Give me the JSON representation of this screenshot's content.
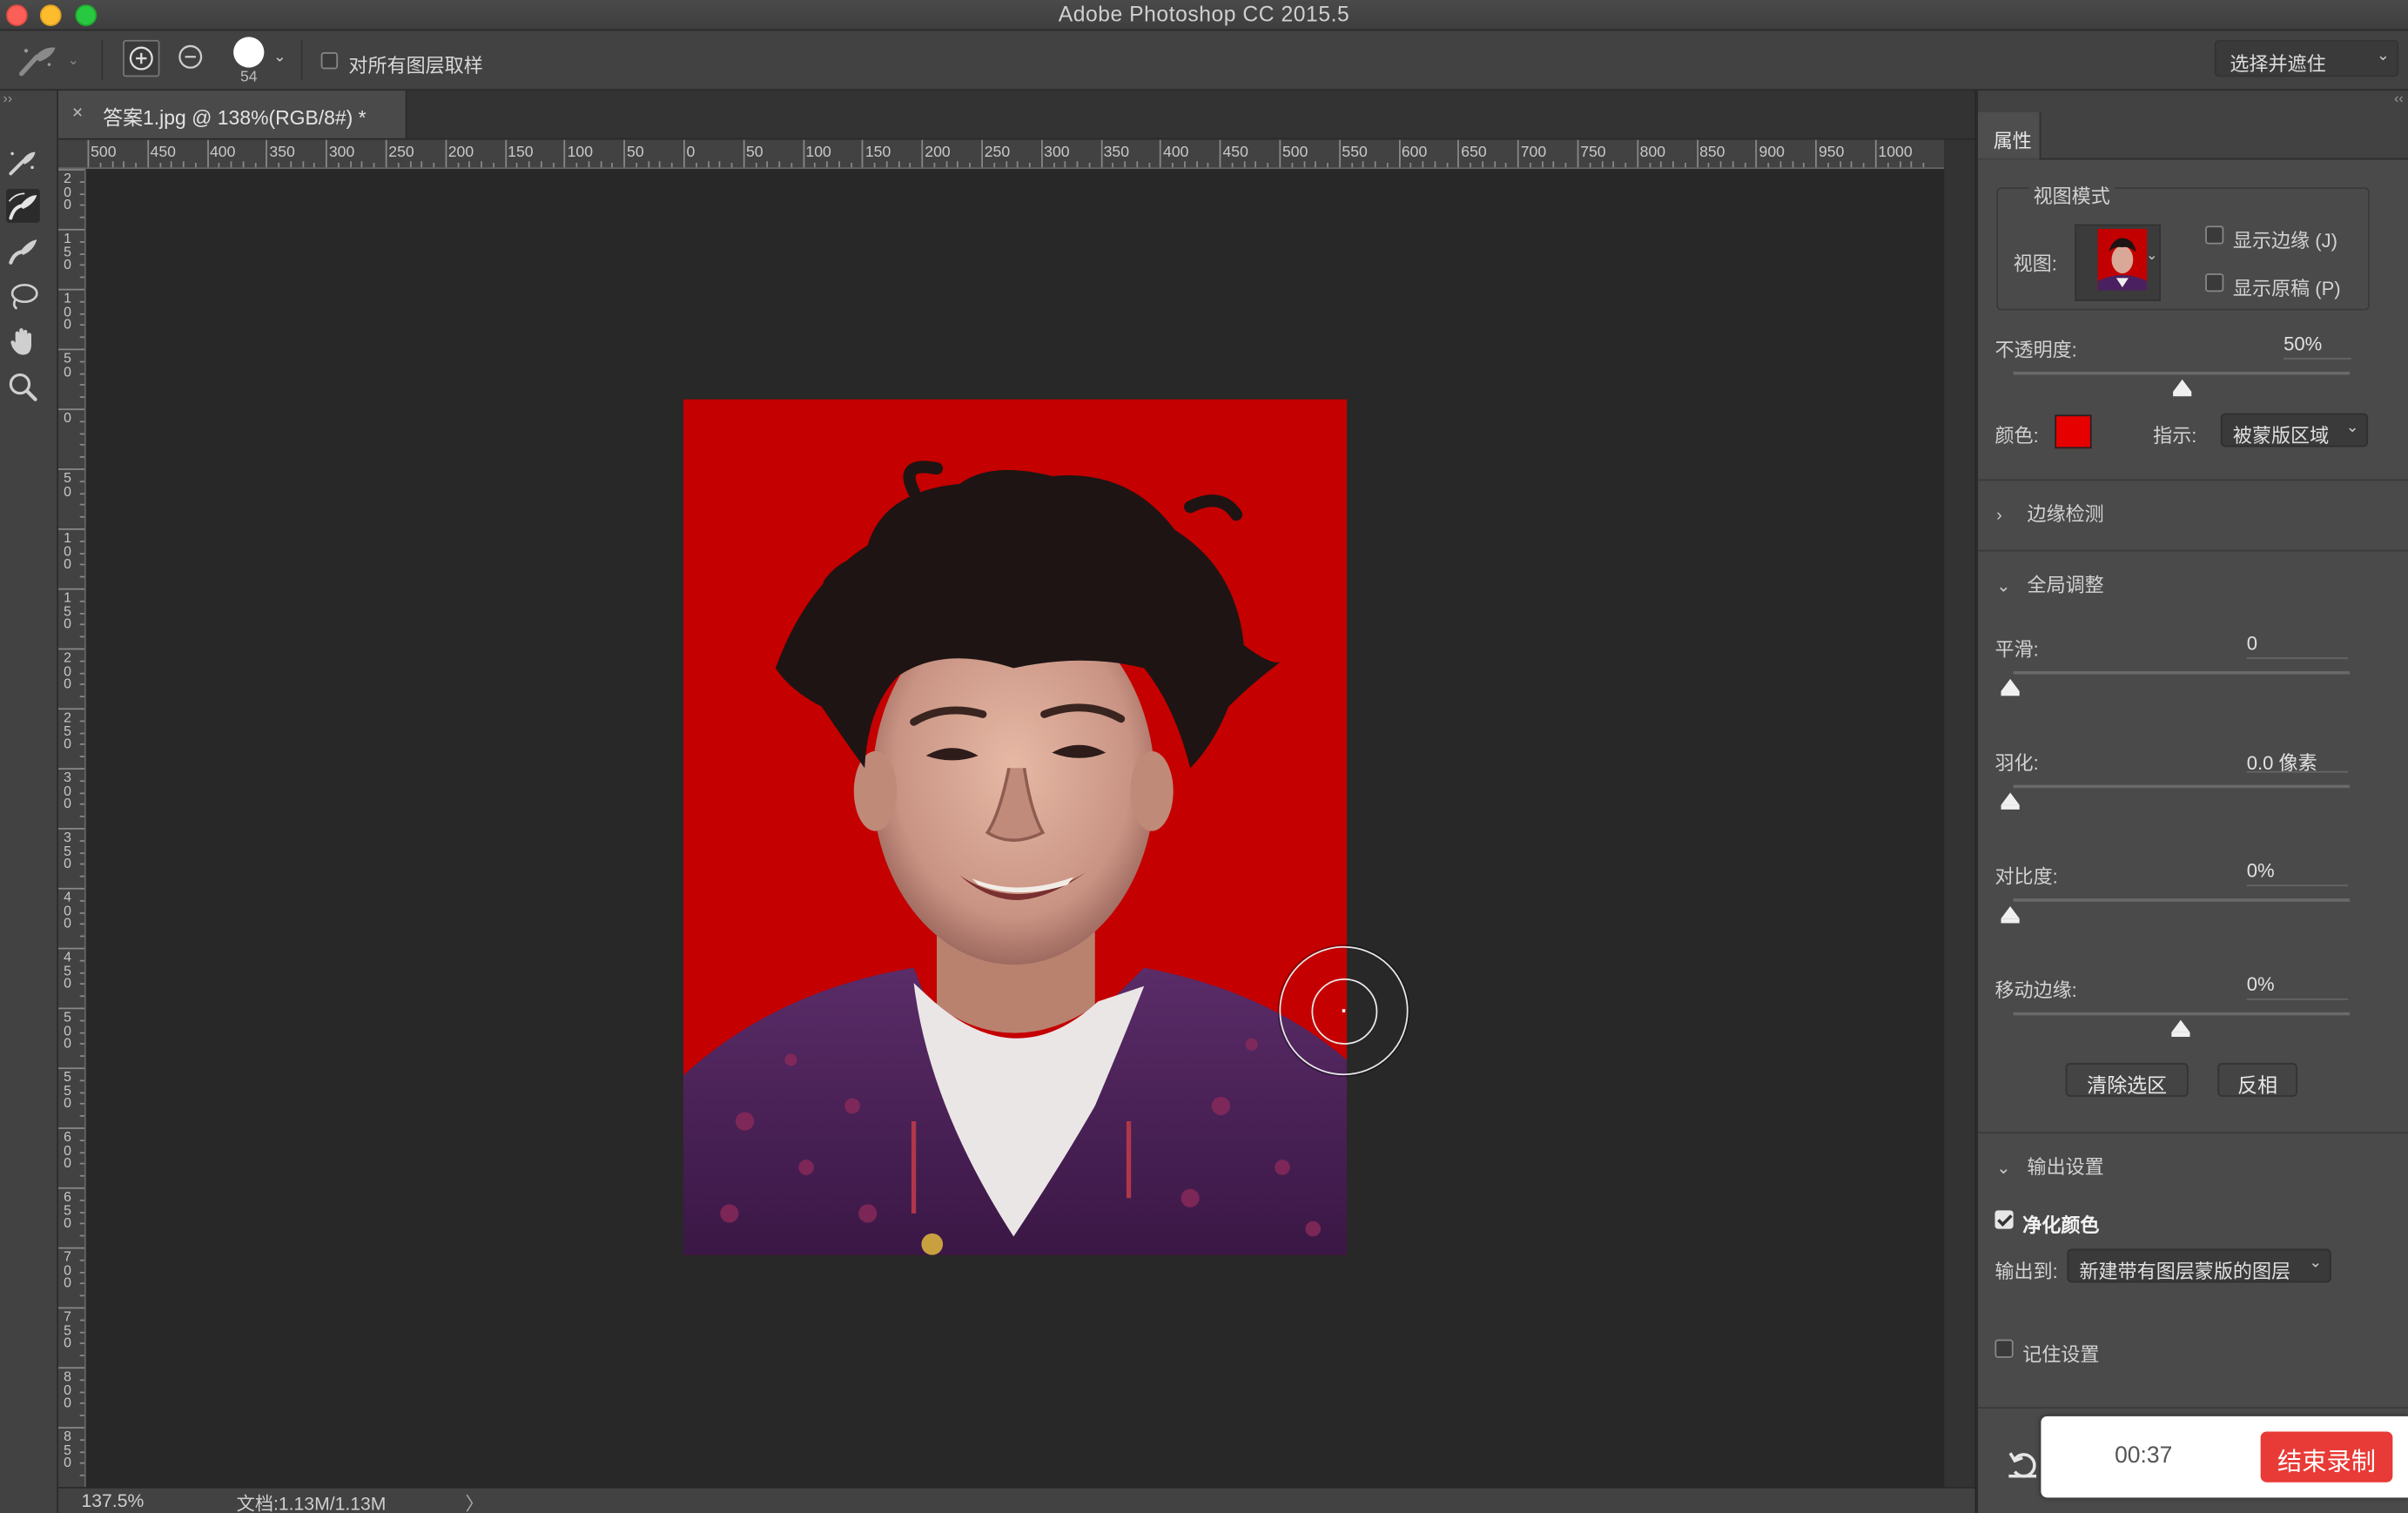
{
  "app": {
    "title": "Adobe Photoshop CC 2015.5"
  },
  "options_bar": {
    "brush_size": "54",
    "sample_all_layers_label": "对所有图层取样",
    "select_and_mask_label": "选择并遮住"
  },
  "document": {
    "tab_title": "答案1.jpg @ 138%(RGB/8#) *",
    "close_glyph": "×"
  },
  "rulers": {
    "horizontal": [
      "500",
      "450",
      "400",
      "350",
      "300",
      "250",
      "200",
      "150",
      "100",
      "50",
      "0",
      "50",
      "100",
      "150",
      "200",
      "250",
      "300",
      "350",
      "400",
      "450",
      "500",
      "550",
      "600",
      "650",
      "700",
      "750",
      "800",
      "850",
      "900",
      "950",
      "1000"
    ],
    "vertical": [
      "2\n0\n0",
      "1\n5\n0",
      "1\n0\n0",
      "5\n0",
      "0",
      "5\n0",
      "1\n0\n0",
      "1\n5\n0",
      "2\n0\n0",
      "2\n5\n0",
      "3\n0\n0",
      "3\n5\n0",
      "4\n0\n0",
      "4\n5\n0",
      "5\n0\n0",
      "5\n5\n0",
      "6\n0\n0",
      "6\n5\n0",
      "7\n0\n0",
      "7\n5\n0",
      "8\n0\n0",
      "8\n5\n0"
    ]
  },
  "status_bar": {
    "zoom": "137.5%",
    "doc_size": "文档:1.13M/1.13M",
    "arrow": "〉"
  },
  "properties_panel": {
    "tab_label": "属性",
    "view_mode_title": "视图模式",
    "view_label": "视图:",
    "show_edge_label": "显示边缘 (J)",
    "show_original_label": "显示原稿 (P)",
    "opacity_label": "不透明度:",
    "opacity_value": "50%",
    "opacity_fraction": 0.5,
    "color_label": "颜色:",
    "color_value": "#e60000",
    "indicate_label": "指示:",
    "indicate_value": "被蒙版区域",
    "edge_detection_label": "边缘检测",
    "global_refine_label": "全局调整",
    "smooth_label": "平滑:",
    "smooth_value": "0",
    "feather_label": "羽化:",
    "feather_value": "0.0 像素",
    "contrast_label": "对比度:",
    "contrast_value": "0%",
    "shift_edge_label": "移动边缘:",
    "shift_edge_value": "0%",
    "clear_selection_label": "清除选区",
    "invert_label": "反相",
    "output_settings_label": "输出设置",
    "decontaminate_label": "净化颜色",
    "decontaminate_checked": true,
    "output_to_label": "输出到:",
    "output_to_value": "新建带有图层蒙版的图层",
    "remember_label": "记住设置"
  },
  "recording": {
    "time": "00:37",
    "stop_label": "结束录制",
    "stop_color": "#e83a36"
  }
}
